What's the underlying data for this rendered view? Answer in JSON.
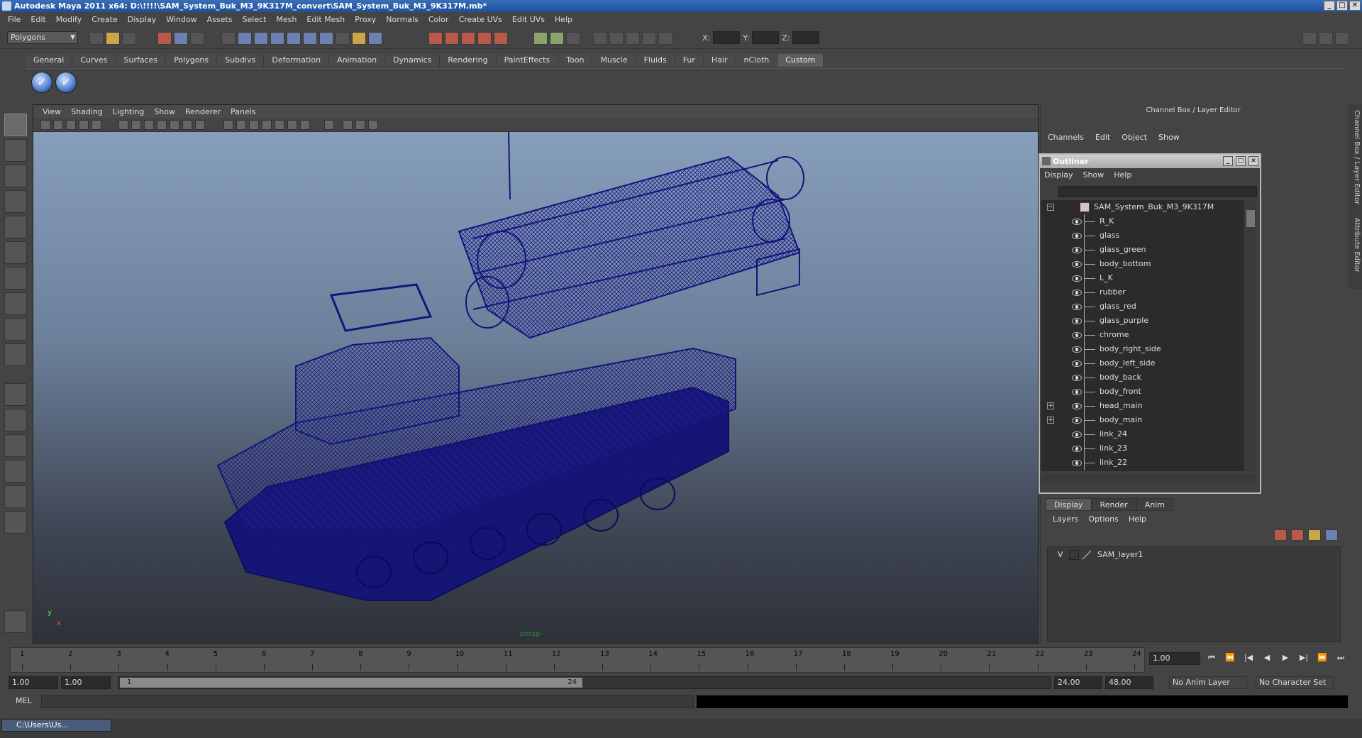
{
  "window": {
    "title": "Autodesk Maya 2011 x64: D:\\!!!!\\SAM_System_Buk_M3_9K317M_convert\\SAM_System_Buk_M3_9K317M.mb*",
    "controls": [
      "_",
      "□",
      "✕"
    ]
  },
  "menubar": [
    "File",
    "Edit",
    "Modify",
    "Create",
    "Display",
    "Window",
    "Assets",
    "Select",
    "Mesh",
    "Edit Mesh",
    "Proxy",
    "Normals",
    "Color",
    "Create UVs",
    "Edit UVs",
    "Help"
  ],
  "statusline": {
    "mode": "Polygons",
    "x_label": "X:",
    "y_label": "Y:",
    "z_label": "Z:"
  },
  "shelf": {
    "tabs": [
      "General",
      "Curves",
      "Surfaces",
      "Polygons",
      "Subdivs",
      "Deformation",
      "Animation",
      "Dynamics",
      "Rendering",
      "PaintEffects",
      "Toon",
      "Muscle",
      "Fluids",
      "Fur",
      "Hair",
      "nCloth",
      "Custom"
    ],
    "active_tab": "Custom"
  },
  "viewport": {
    "menu": [
      "View",
      "Shading",
      "Lighting",
      "Show",
      "Renderer",
      "Panels"
    ],
    "camera_label": "persp",
    "axis_y": "y",
    "axis_x": "x",
    "wire_color": "#14147a"
  },
  "channel_box": {
    "title": "Channel Box / Layer Editor",
    "menu": [
      "Channels",
      "Edit",
      "Object",
      "Show"
    ],
    "side_tabs": [
      "Channel Box / Layer Editor",
      "Attribute Editor"
    ]
  },
  "outliner": {
    "title": "Outliner",
    "menu": [
      "Display",
      "Show",
      "Help"
    ],
    "root": "SAM_System_Buk_M3_9K317M",
    "items": [
      {
        "label": "R_K",
        "expandable": false
      },
      {
        "label": "glass",
        "expandable": false
      },
      {
        "label": "glass_green",
        "expandable": false
      },
      {
        "label": "body_bottom",
        "expandable": false
      },
      {
        "label": "L_K",
        "expandable": false
      },
      {
        "label": "rubber",
        "expandable": false
      },
      {
        "label": "glass_red",
        "expandable": false
      },
      {
        "label": "glass_purple",
        "expandable": false
      },
      {
        "label": "chrome",
        "expandable": false
      },
      {
        "label": "body_right_side",
        "expandable": false
      },
      {
        "label": "body_left_side",
        "expandable": false
      },
      {
        "label": "body_back",
        "expandable": false
      },
      {
        "label": "body_front",
        "expandable": false
      },
      {
        "label": "head_main",
        "expandable": true
      },
      {
        "label": "body_main",
        "expandable": true
      },
      {
        "label": "link_24",
        "expandable": false
      },
      {
        "label": "link_23",
        "expandable": false
      },
      {
        "label": "link_22",
        "expandable": false
      }
    ]
  },
  "layer_editor": {
    "tabs": [
      "Display",
      "Render",
      "Anim"
    ],
    "active_tab": "Display",
    "menu": [
      "Layers",
      "Options",
      "Help"
    ],
    "layers": [
      {
        "visible": "V",
        "name": "SAM_layer1"
      }
    ]
  },
  "timeline": {
    "ticks": [
      "1",
      "2",
      "3",
      "4",
      "5",
      "6",
      "7",
      "8",
      "9",
      "10",
      "11",
      "12",
      "13",
      "14",
      "15",
      "16",
      "17",
      "18",
      "19",
      "20",
      "21",
      "22",
      "23",
      "24"
    ],
    "current_frame": "1.00",
    "playback_buttons": [
      "⏮",
      "⏪",
      "|◀",
      "◀",
      "▶",
      "▶|",
      "⏩",
      "⏭"
    ]
  },
  "range": {
    "start": "1.00",
    "start2": "1.00",
    "thumb_start": "1",
    "thumb_end": "24",
    "end": "24.00",
    "end2": "48.00",
    "anim_layer": "No Anim Layer",
    "character_set": "No Character Set"
  },
  "commandline": {
    "label": "MEL"
  },
  "taskbar": {
    "item": "C:\\Users\\Us..."
  }
}
